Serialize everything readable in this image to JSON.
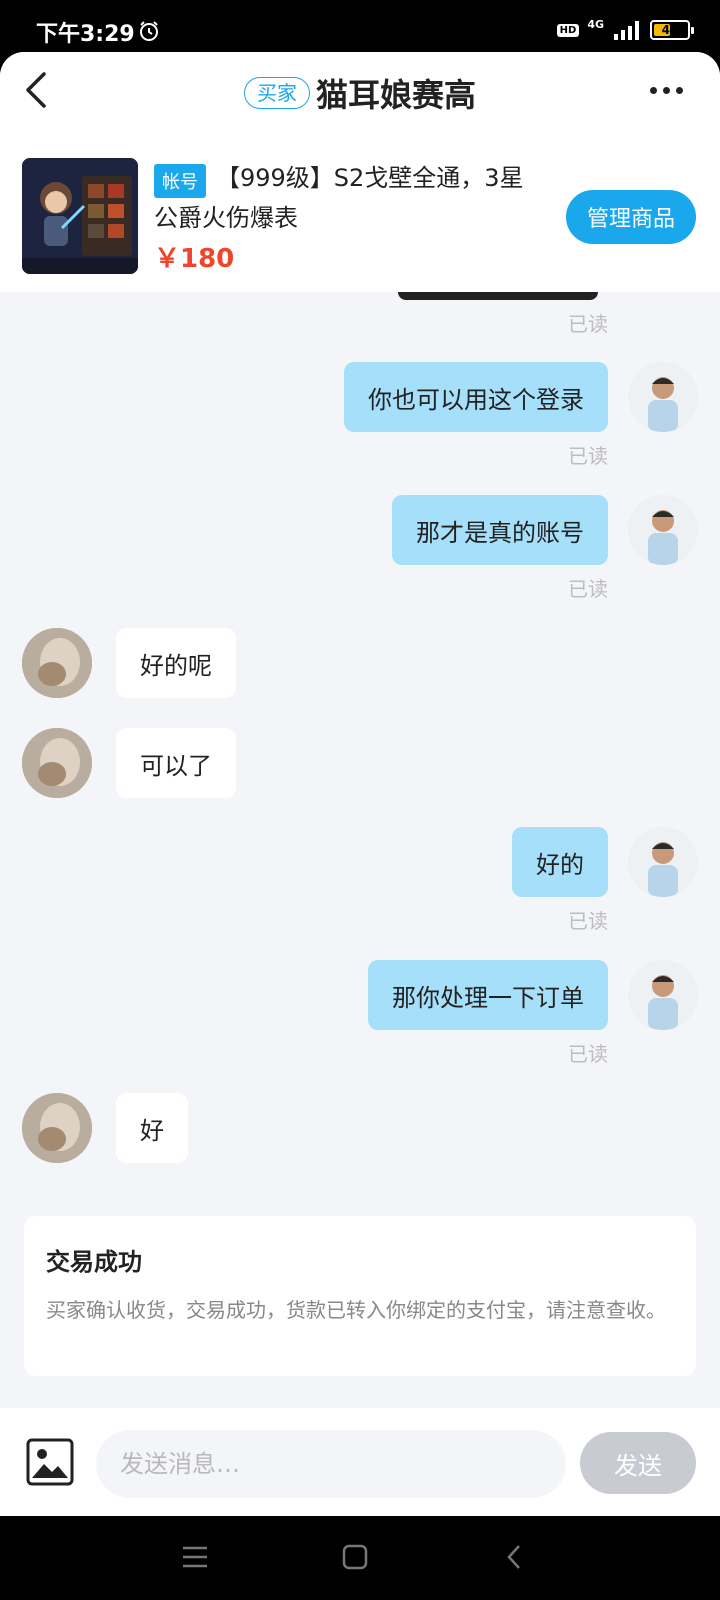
{
  "status_bar": {
    "time": "下午3:29",
    "hd": "HD",
    "network": "4G",
    "battery": "44",
    "battery_level": 0.44
  },
  "header": {
    "role_badge": "买家",
    "title": "猫耳娘赛高"
  },
  "product": {
    "tag": "帐号",
    "title": "【999级】S2戈壁全通，3星公爵火伤爆表",
    "price": "￥180",
    "manage_label": "管理商品"
  },
  "read_label": "已读",
  "messages": [
    {
      "side": "mine",
      "text": "你也可以用这个登录",
      "read": "已读"
    },
    {
      "side": "mine",
      "text": "那才是真的账号",
      "read": "已读"
    },
    {
      "side": "theirs",
      "text": "好的呢"
    },
    {
      "side": "theirs",
      "text": "可以了"
    },
    {
      "side": "mine",
      "text": "好的",
      "read": "已读"
    },
    {
      "side": "mine",
      "text": "那你处理一下订单",
      "read": "已读"
    },
    {
      "side": "theirs",
      "text": "好"
    }
  ],
  "notice": {
    "title": "交易成功",
    "body": "买家确认收货，交易成功，货款已转入你绑定的支付宝，请注意查收。"
  },
  "input": {
    "placeholder": "发送消息…",
    "send_label": "发送"
  },
  "colors": {
    "accent": "#1aa7ec",
    "my_bubble": "#a6dffa",
    "price": "#f0442c",
    "background": "#f4f5f9"
  },
  "icons": {
    "back": "chevron-left-icon",
    "more": "more-dots-icon",
    "image": "image-icon",
    "alarm": "alarm-clock-icon"
  }
}
